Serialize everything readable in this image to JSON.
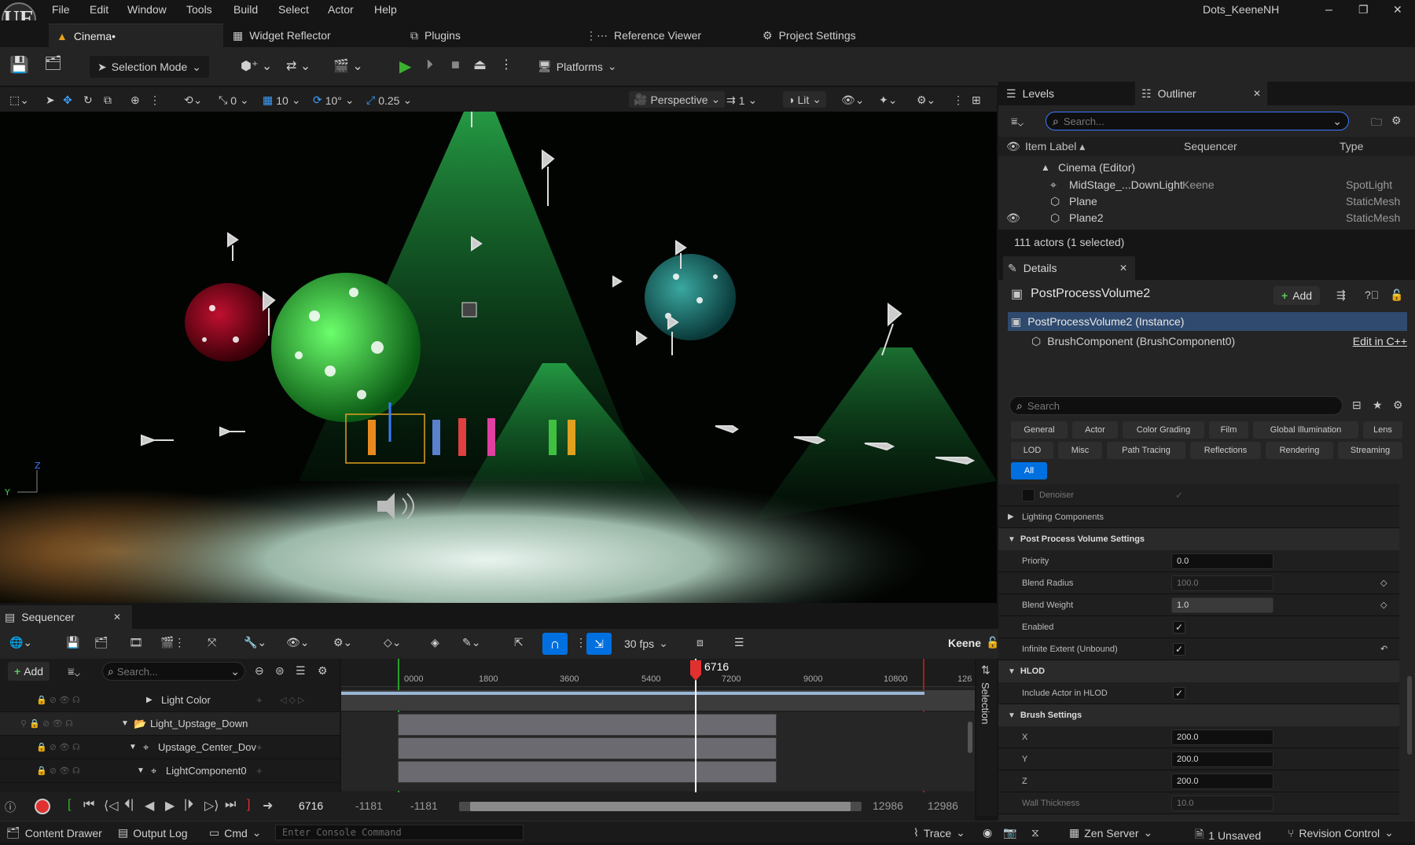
{
  "app": {
    "project_name": "Dots_KeeneNH",
    "logo": "UE"
  },
  "menu": [
    "File",
    "Edit",
    "Window",
    "Tools",
    "Build",
    "Select",
    "Actor",
    "Help"
  ],
  "window_controls": {
    "minimize": "–",
    "maximize": "❐",
    "close": "✕"
  },
  "tabs": {
    "level": "Cinema•",
    "widget_reflector": "Widget Reflector",
    "plugins": "Plugins",
    "reference_viewer": "Reference Viewer",
    "project_settings": "Project Settings"
  },
  "toolbar": {
    "selection_mode": "Selection Mode",
    "platforms": "Platforms"
  },
  "viewport_toolbar": {
    "rotate_snap_value": "0",
    "grid_value": "10",
    "angle_value": "10°",
    "scale_value": "0.25",
    "perspective": "Perspective",
    "camera_speed": "1",
    "view_mode": "Lit"
  },
  "outliner": {
    "levels_tab": "Levels",
    "outliner_tab": "Outliner",
    "search_placeholder": "Search...",
    "columns": {
      "label": "Item Label ▴",
      "sequencer": "Sequencer",
      "type": "Type"
    },
    "items": [
      {
        "label": "Cinema (Editor)",
        "sequencer": "",
        "type": ""
      },
      {
        "label": "MidStage_...DownLight",
        "sequencer": "Keene",
        "type": "SpotLight"
      },
      {
        "label": "Plane",
        "sequencer": "",
        "type": "StaticMesh"
      },
      {
        "label": "Plane2",
        "sequencer": "",
        "type": "StaticMesh"
      }
    ],
    "footer": "111 actors (1 selected)"
  },
  "details": {
    "tab": "Details",
    "actor_name": "PostProcessVolume2",
    "add_label": "Add",
    "instance": "PostProcessVolume2 (Instance)",
    "component": "BrushComponent (BrushComponent0)",
    "edit_cpp": "Edit in C++",
    "search_placeholder": "Search",
    "categories_row1": [
      "General",
      "Actor",
      "Color Grading",
      "Film",
      "Global Illumination",
      "Lens"
    ],
    "categories_row2": [
      "LOD",
      "Misc",
      "Path Tracing",
      "Reflections",
      "Rendering",
      "Streaming"
    ],
    "category_all": "All",
    "denoiser": "Denoiser",
    "lighting_components": "Lighting Components",
    "section_ppv": "Post Process Volume Settings",
    "priority": {
      "label": "Priority",
      "value": "0.0"
    },
    "blend_radius": {
      "label": "Blend Radius",
      "value": "100.0"
    },
    "blend_weight": {
      "label": "Blend Weight",
      "value": "1.0"
    },
    "enabled": {
      "label": "Enabled",
      "checked": "✓"
    },
    "infinite_extent": {
      "label": "Infinite Extent (Unbound)",
      "checked": "✓"
    },
    "section_hlod": "HLOD",
    "include_hlod": {
      "label": "Include Actor in HLOD",
      "checked": "✓"
    },
    "section_brush": "Brush Settings",
    "brush_x": {
      "label": "X",
      "value": "200.0"
    },
    "brush_y": {
      "label": "Y",
      "value": "200.0"
    },
    "brush_z": {
      "label": "Z",
      "value": "200.0"
    },
    "wall_thickness": {
      "label": "Wall Thickness",
      "value": "10.0"
    }
  },
  "sequencer": {
    "tab": "Sequencer",
    "add_label": "Add",
    "search_placeholder": "Search...",
    "fps": "30 fps",
    "sequence_name": "Keene",
    "selection_label": "Selection",
    "ruler_ticks": [
      "0000",
      "1800",
      "3600",
      "5400",
      "7200",
      "9000",
      "10800",
      "126"
    ],
    "playhead_frame": "6716",
    "tracks": [
      {
        "label": "Light Color",
        "indent": 0
      },
      {
        "label": "Light_Upstage_Down",
        "indent": 0
      },
      {
        "label": "Upstage_Center_Dov",
        "indent": 1
      },
      {
        "label": "LightComponent0",
        "indent": 2
      }
    ],
    "current_frame": "6716",
    "range_start_a": "-1181",
    "range_start_b": "-1181",
    "range_end_a": "12986",
    "range_end_b": "12986"
  },
  "statusbar": {
    "content_drawer": "Content Drawer",
    "output_log": "Output Log",
    "cmd": "Cmd",
    "console_placeholder": "Enter Console Command",
    "trace": "Trace",
    "zen_server": "Zen Server",
    "unsaved": "1 Unsaved",
    "revision_control": "Revision Control"
  },
  "colors": {
    "accent_blue": "#0070e0",
    "selected_row": "#2f4a6e",
    "playhead_red": "#e03030",
    "play_green": "#3cb030"
  }
}
